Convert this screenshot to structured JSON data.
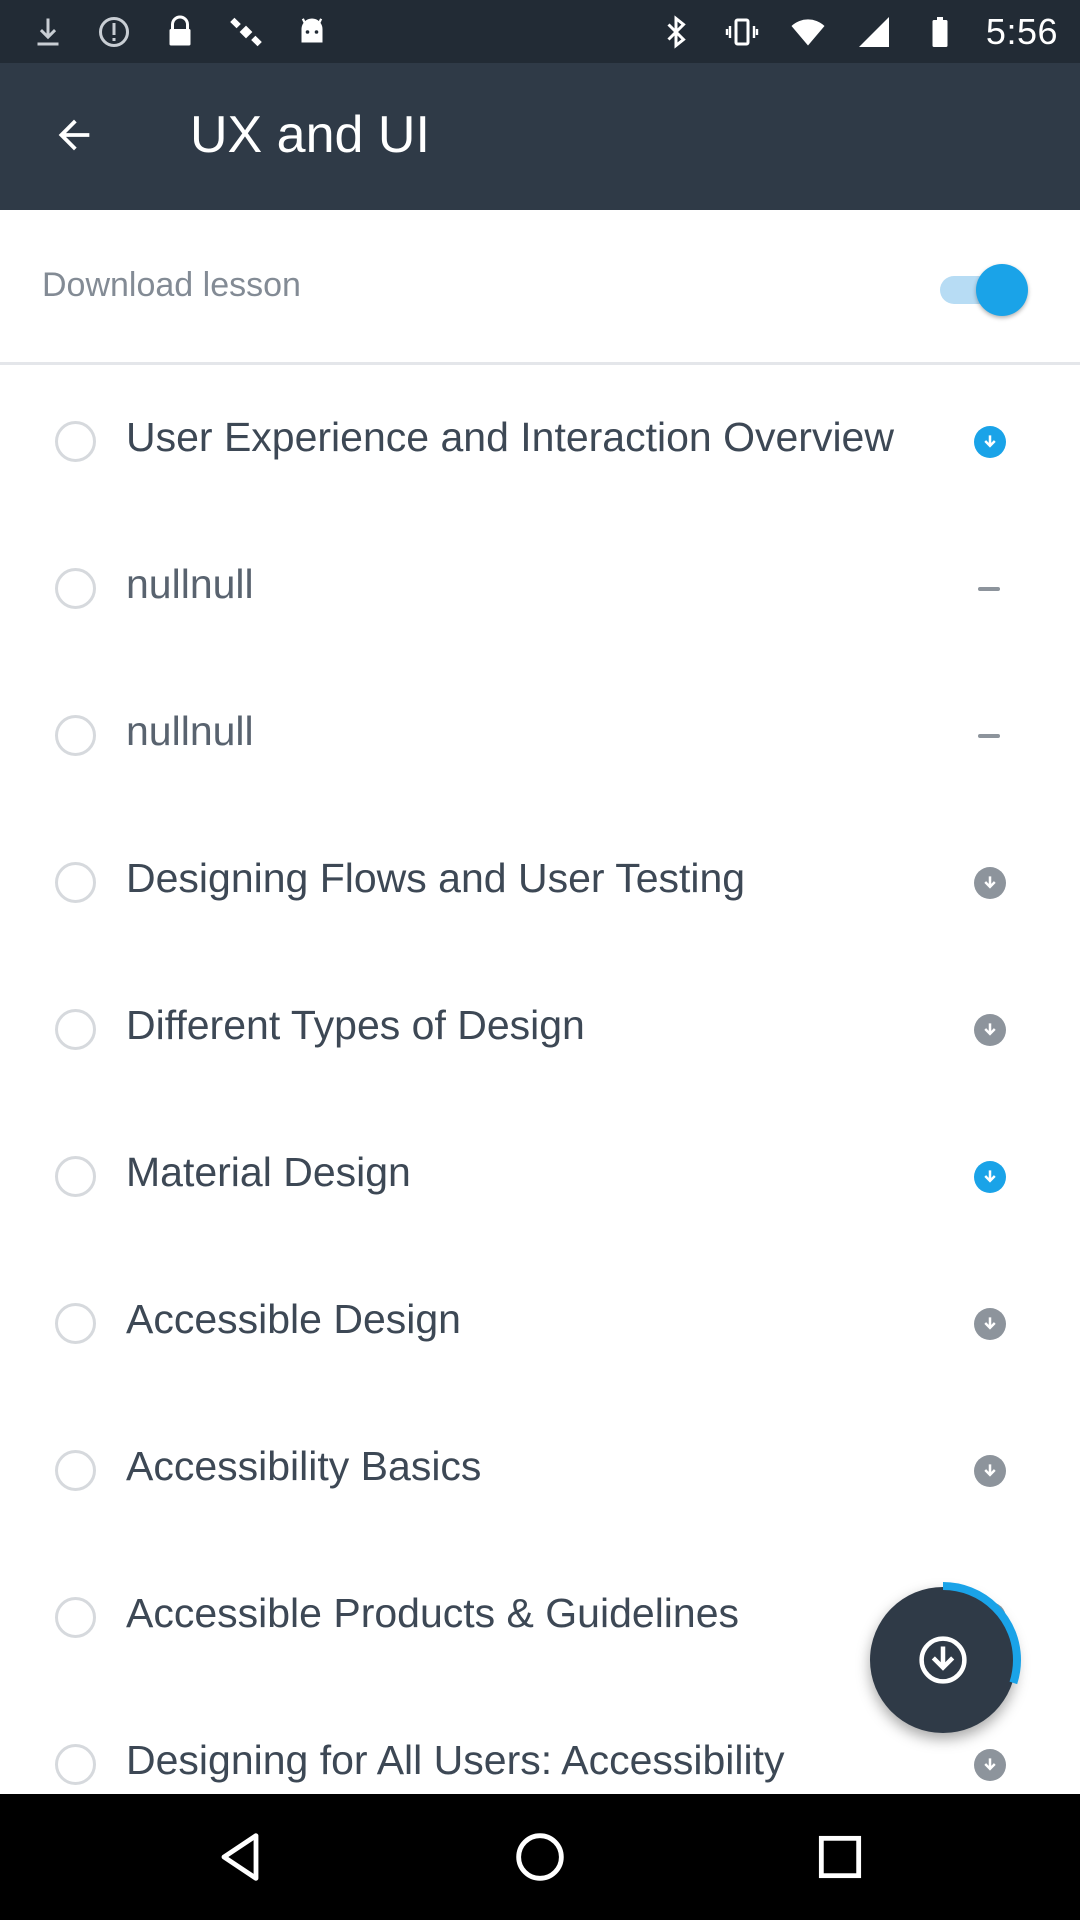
{
  "status_bar": {
    "time": "5:56",
    "left_icons": [
      "download-icon",
      "alert-icon",
      "lock-icon",
      "satellite-icon",
      "android-icon"
    ],
    "right_icons": [
      "bluetooth-icon",
      "vibrate-icon",
      "wifi-icon",
      "signal-icon",
      "battery-icon"
    ]
  },
  "app_bar": {
    "title": "UX and UI",
    "back_icon": "arrow-back-icon"
  },
  "download_lesson": {
    "label": "Download lesson",
    "enabled": true
  },
  "colors": {
    "status_bar_bg": "#222b35",
    "app_bar_bg": "#2f3a47",
    "accent": "#1aa3e8",
    "icon_gray": "#8d949c"
  },
  "lessons": [
    {
      "title": "User Experience and Interaction Overview",
      "status": "download-accent"
    },
    {
      "title": "nullnull",
      "status": "dash"
    },
    {
      "title": "nullnull",
      "status": "dash"
    },
    {
      "title": "Designing Flows and User Testing",
      "status": "download"
    },
    {
      "title": "Different Types of Design",
      "status": "download"
    },
    {
      "title": "Material Design",
      "status": "download-accent"
    },
    {
      "title": "Accessible Design",
      "status": "download"
    },
    {
      "title": "Accessibility Basics",
      "status": "download"
    },
    {
      "title": "Accessible Products & Guidelines",
      "status": "download"
    },
    {
      "title": "Designing for All Users: Accessibility",
      "status": "download"
    }
  ],
  "fab": {
    "icon": "download-circle-icon",
    "progress": 0.3
  },
  "nav_bar": {
    "buttons": [
      "back-triangle-icon",
      "home-circle-icon",
      "recents-square-icon"
    ]
  }
}
